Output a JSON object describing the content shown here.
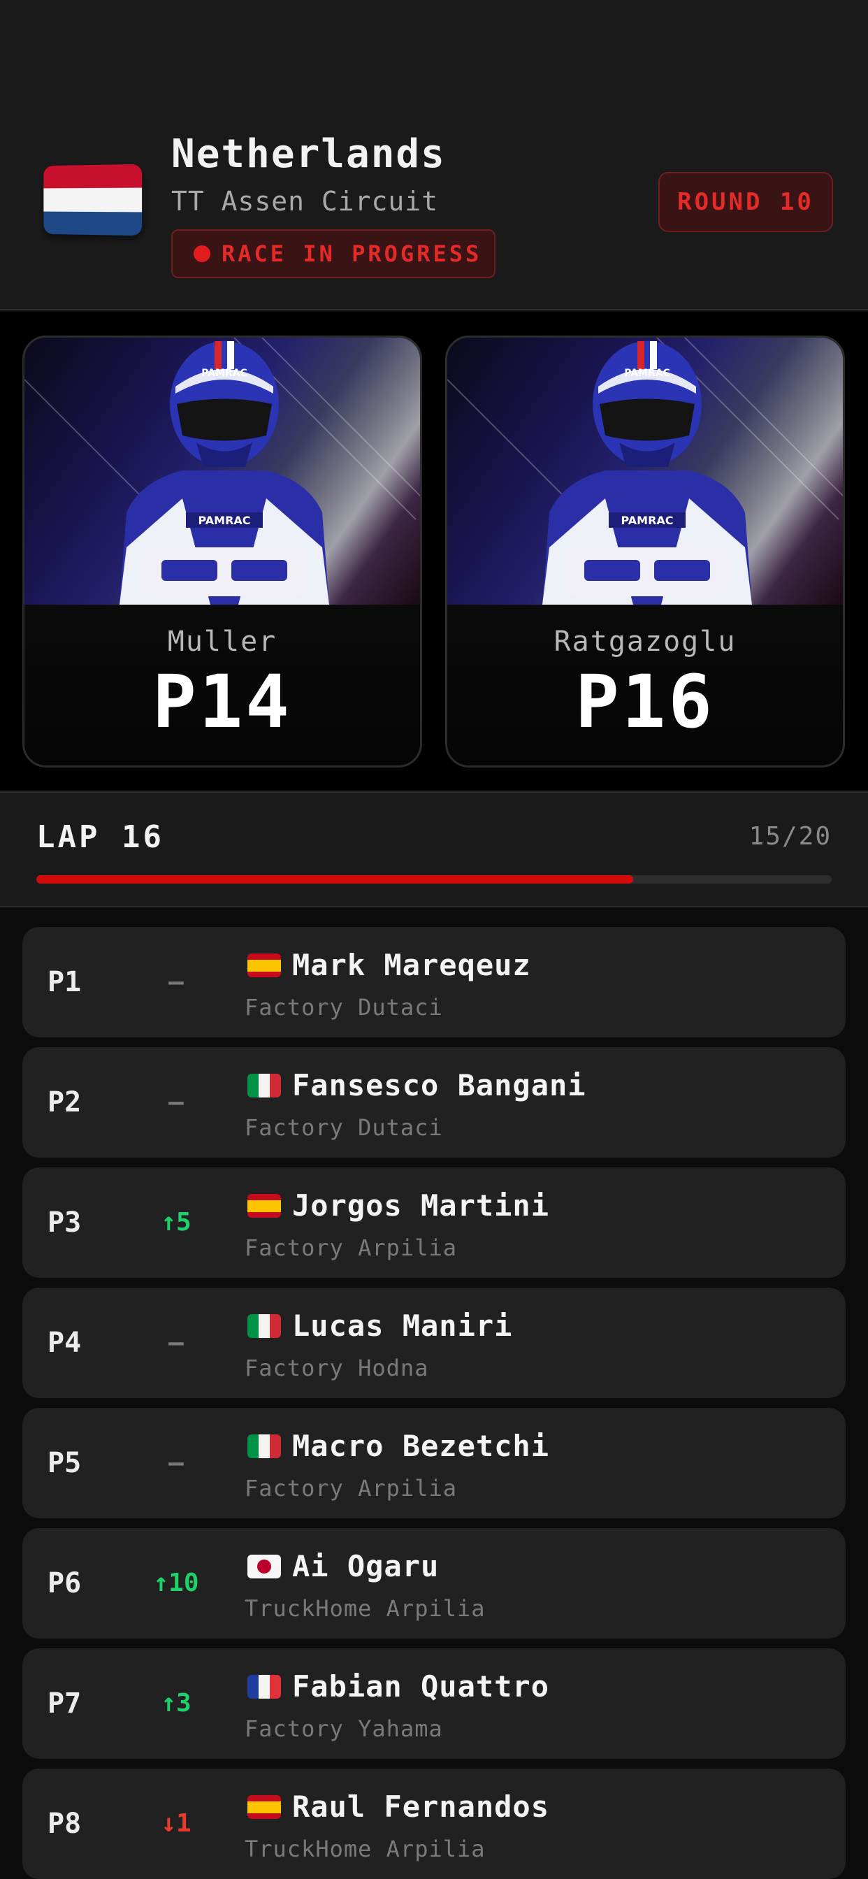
{
  "event": {
    "country": "Netherlands",
    "circuit": "TT Assen Circuit",
    "status": "RACE IN PROGRESS",
    "round": "ROUND 10",
    "flag": "netherlands-flag"
  },
  "featured_riders": [
    {
      "name": "Muller",
      "position": "P14"
    },
    {
      "name": "Ratgazoglu",
      "position": "P16"
    }
  ],
  "lap": {
    "title": "LAP 16",
    "count": "15/20",
    "progress": 0.75
  },
  "standings": [
    {
      "pos": "P1",
      "change": "–",
      "trend": "none",
      "flag": "spain-flag",
      "name": "Mark Mareqeuz",
      "team": "Factory Dutaci"
    },
    {
      "pos": "P2",
      "change": "–",
      "trend": "none",
      "flag": "italy-flag",
      "name": "Fansesco Bangani",
      "team": "Factory Dutaci"
    },
    {
      "pos": "P3",
      "change": "↑5",
      "trend": "up",
      "flag": "spain-flag",
      "name": "Jorgos Martini",
      "team": "Factory Arpilia"
    },
    {
      "pos": "P4",
      "change": "–",
      "trend": "none",
      "flag": "italy-flag",
      "name": "Lucas Maniri",
      "team": "Factory Hodna"
    },
    {
      "pos": "P5",
      "change": "–",
      "trend": "none",
      "flag": "italy-flag",
      "name": "Macro Bezetchi",
      "team": "Factory Arpilia"
    },
    {
      "pos": "P6",
      "change": "↑10",
      "trend": "up",
      "flag": "japan-flag",
      "name": "Ai Ogaru",
      "team": "TruckHome Arpilia"
    },
    {
      "pos": "P7",
      "change": "↑3",
      "trend": "up",
      "flag": "france-flag",
      "name": "Fabian Quattro",
      "team": "Factory Yahama"
    },
    {
      "pos": "P8",
      "change": "↓1",
      "trend": "down",
      "flag": "spain-flag",
      "name": "Raul Fernandos",
      "team": "TruckHome Arpilia"
    }
  ],
  "colors": {
    "accent_red": "#d40b0b",
    "up": "#1fd16b",
    "down": "#e63a2e",
    "neutral": "#7a7a7a"
  }
}
